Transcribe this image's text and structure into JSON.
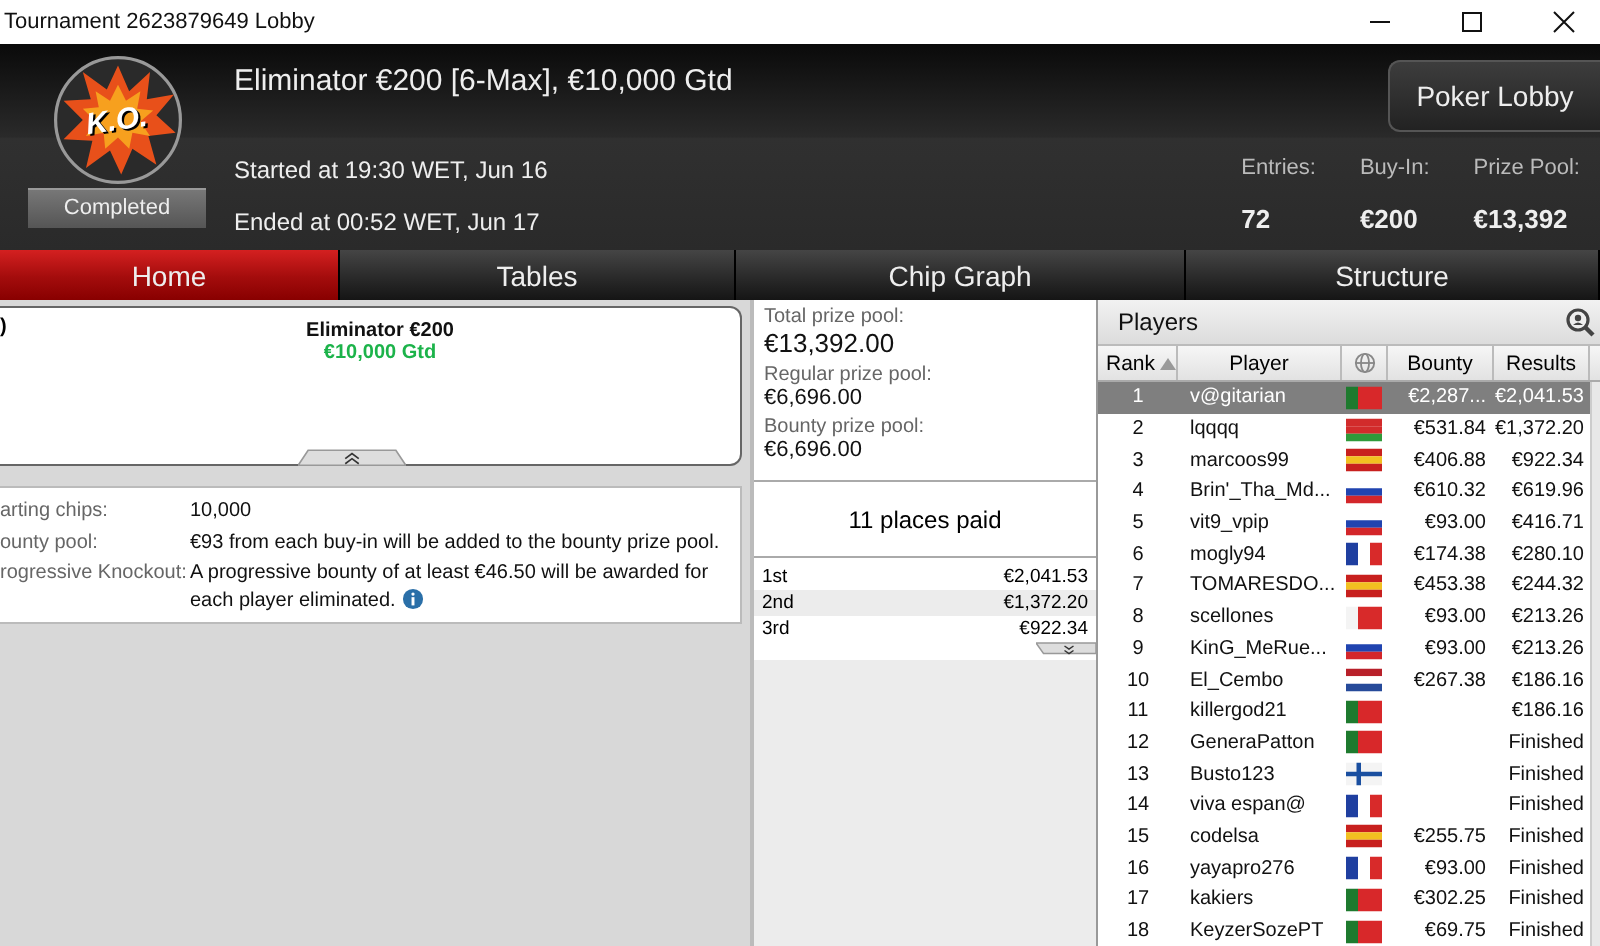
{
  "window": {
    "title": "Tournament 2623879649 Lobby"
  },
  "header": {
    "logo_text": "K.O.",
    "status": "Completed",
    "title": "Eliminator €200 [6-Max], €10,000 Gtd",
    "started": "Started at 19:30 WET, Jun 16",
    "ended": "Ended at 00:52 WET, Jun 17",
    "lobby_button": "Poker Lobby",
    "stats": [
      {
        "label": "Entries:",
        "value": "72"
      },
      {
        "label": "Buy-In:",
        "value": "€200"
      },
      {
        "label": "Prize Pool:",
        "value": "€13,392"
      }
    ]
  },
  "tabs": [
    {
      "label": "Home",
      "selected": true
    },
    {
      "label": "Tables",
      "selected": false
    },
    {
      "label": "Chip Graph",
      "selected": false
    },
    {
      "label": "Structure",
      "selected": false
    }
  ],
  "banner": {
    "cut_text": ")",
    "name": "Eliminator €200",
    "guarantee": "€10,000 Gtd"
  },
  "info": [
    {
      "label": "arting chips:",
      "value": "10,000",
      "info_icon": false
    },
    {
      "label": "ounty pool:",
      "value": "€93 from each buy-in will be added to the bounty prize pool.",
      "info_icon": false
    },
    {
      "label": "rogressive Knockout:",
      "value": "A progressive bounty of at least €46.50 will be awarded for each player eliminated.",
      "info_icon": true
    }
  ],
  "pools": [
    {
      "label": "Total prize pool:",
      "value": "€13,392.00"
    },
    {
      "label": "Regular prize pool:",
      "value": "€6,696.00"
    },
    {
      "label": "Bounty prize pool:",
      "value": "€6,696.00"
    }
  ],
  "places_paid": "11 places paid",
  "payouts": [
    {
      "place": "1st",
      "amount": "€2,041.53"
    },
    {
      "place": "2nd",
      "amount": "€1,372.20"
    },
    {
      "place": "3rd",
      "amount": "€922.34"
    }
  ],
  "players": {
    "title": "Players",
    "columns": [
      "Rank",
      "Player",
      "Bounty",
      "Results"
    ],
    "rows": [
      {
        "rank": "1",
        "name": "v@gitarian",
        "kind": "vertical",
        "stripes": [
          {
            "color": "#1e7a2e"
          },
          {
            "color": "#d8282a"
          },
          {
            "color": "#d8282a"
          }
        ],
        "bounty": "€2,287...",
        "result": "€2,041.53",
        "selected": true
      },
      {
        "rank": "2",
        "name": "lqqqq",
        "kind": "horizontal",
        "stripes": [
          {
            "color": "#d22b2b"
          },
          {
            "color": "#d22b2b"
          },
          {
            "color": "#2f9a3a"
          }
        ],
        "bounty": "€531.84",
        "result": "€1,372.20",
        "selected": false
      },
      {
        "rank": "3",
        "name": "marcoos99",
        "kind": "horizontal",
        "stripes": [
          {
            "color": "#c8201e"
          },
          {
            "color": "#f2c020"
          },
          {
            "color": "#c8201e"
          }
        ],
        "bounty": "€406.88",
        "result": "€922.34",
        "selected": false
      },
      {
        "rank": "4",
        "name": "Brin'_Tha_Md...",
        "kind": "horizontal",
        "stripes": [
          {
            "color": "#ffffff"
          },
          {
            "color": "#2044b0"
          },
          {
            "color": "#d3262a"
          }
        ],
        "bounty": "€610.32",
        "result": "€619.96",
        "selected": false
      },
      {
        "rank": "5",
        "name": "vit9_vpip",
        "kind": "horizontal",
        "stripes": [
          {
            "color": "#ffffff"
          },
          {
            "color": "#2044b0"
          },
          {
            "color": "#d3262a"
          }
        ],
        "bounty": "€93.00",
        "result": "€416.71",
        "selected": false
      },
      {
        "rank": "6",
        "name": "mogly94",
        "kind": "vertical",
        "stripes": [
          {
            "color": "#1f3fa0"
          },
          {
            "color": "#ffffff"
          },
          {
            "color": "#d82a2a"
          }
        ],
        "bounty": "€174.38",
        "result": "€280.10",
        "selected": false
      },
      {
        "rank": "7",
        "name": "TOMARESDO...",
        "kind": "horizontal",
        "stripes": [
          {
            "color": "#c8201e"
          },
          {
            "color": "#f2c020"
          },
          {
            "color": "#c8201e"
          }
        ],
        "bounty": "€453.38",
        "result": "€244.32",
        "selected": false
      },
      {
        "rank": "8",
        "name": "scellones",
        "kind": "vertical",
        "stripes": [
          {
            "color": "#f4f4f4"
          },
          {
            "color": "#d82a2a"
          },
          {
            "color": "#d82a2a"
          }
        ],
        "bounty": "€93.00",
        "result": "€213.26",
        "selected": false
      },
      {
        "rank": "9",
        "name": "KinG_MeRue...",
        "kind": "horizontal",
        "stripes": [
          {
            "color": "#ffffff"
          },
          {
            "color": "#2044b0"
          },
          {
            "color": "#d3262a"
          }
        ],
        "bounty": "€93.00",
        "result": "€213.26",
        "selected": false
      },
      {
        "rank": "10",
        "name": "El_Cembo",
        "kind": "horizontal",
        "stripes": [
          {
            "color": "#b8202a"
          },
          {
            "color": "#ffffff"
          },
          {
            "color": "#264a9a"
          }
        ],
        "bounty": "€267.38",
        "result": "€186.16",
        "selected": false
      },
      {
        "rank": "11",
        "name": "killergod21",
        "kind": "vertical",
        "stripes": [
          {
            "color": "#1e7a2e"
          },
          {
            "color": "#d8282a"
          },
          {
            "color": "#d8282a"
          }
        ],
        "result": "€186.16",
        "selected": false
      },
      {
        "rank": "12",
        "name": "GeneraPatton",
        "kind": "vertical",
        "stripes": [
          {
            "color": "#1e7a2e"
          },
          {
            "color": "#d8282a"
          },
          {
            "color": "#d8282a"
          }
        ],
        "result": "Finished",
        "selected": false
      },
      {
        "rank": "13",
        "name": "Busto123",
        "kind": "cross",
        "stripes": [
          {
            "color": "#f4f4f4"
          },
          {
            "color": "#1a4fa0"
          }
        ],
        "result": "Finished",
        "selected": false
      },
      {
        "rank": "14",
        "name": "viva espan@",
        "kind": "vertical",
        "stripes": [
          {
            "color": "#1f3fa0"
          },
          {
            "color": "#ffffff"
          },
          {
            "color": "#d82a2a"
          }
        ],
        "result": "Finished",
        "selected": false
      },
      {
        "rank": "15",
        "name": "codelsa",
        "kind": "horizontal",
        "stripes": [
          {
            "color": "#c8201e"
          },
          {
            "color": "#f2c020"
          },
          {
            "color": "#c8201e"
          }
        ],
        "bounty": "€255.75",
        "result": "Finished",
        "selected": false
      },
      {
        "rank": "16",
        "name": "yayapro276",
        "kind": "vertical",
        "stripes": [
          {
            "color": "#1f3fa0"
          },
          {
            "color": "#ffffff"
          },
          {
            "color": "#d82a2a"
          }
        ],
        "bounty": "€93.00",
        "result": "Finished",
        "selected": false
      },
      {
        "rank": "17",
        "name": "kakiers",
        "kind": "vertical",
        "stripes": [
          {
            "color": "#1e7a2e"
          },
          {
            "color": "#d8282a"
          },
          {
            "color": "#d8282a"
          }
        ],
        "bounty": "€302.25",
        "result": "Finished",
        "selected": false
      },
      {
        "rank": "18",
        "name": "KeyzerSozePT",
        "kind": "vertical",
        "stripes": [
          {
            "color": "#1e7a2e"
          },
          {
            "color": "#d8282a"
          },
          {
            "color": "#d8282a"
          }
        ],
        "bounty": "€69.75",
        "result": "Finished",
        "selected": false
      }
    ]
  }
}
